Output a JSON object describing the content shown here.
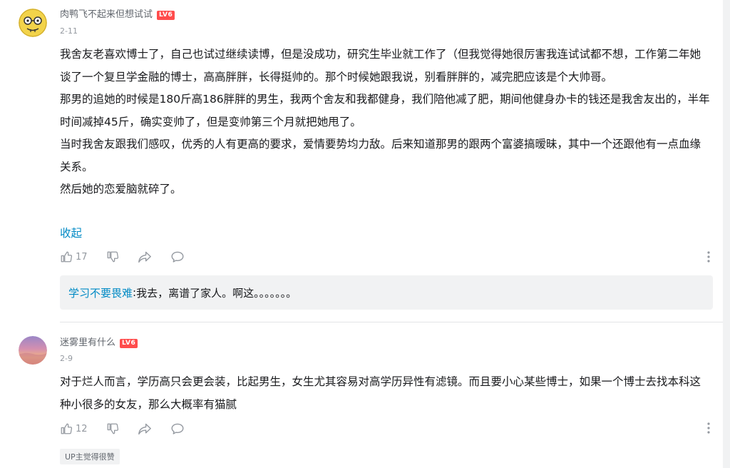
{
  "comments": [
    {
      "username": "肉鸭飞不起来但想试试",
      "level": "LV6",
      "date": "2-11",
      "paragraphs": [
        "我舍友老喜欢博士了，自己也试过继续读博，但是没成功，研究生毕业就工作了（但我觉得她很厉害我连试试都不想，工作第二年她谈了一个复旦学金融的博士，高高胖胖，长得挺帅的。那个时候她跟我说，别看胖胖的，减完肥应该是个大帅哥。",
        "那男的追她的时候是180斤高186胖胖的男生，我两个舍友和我都健身，我们陪他减了肥，期间他健身办卡的钱还是我舍友出的，半年时间减掉45斤，确实变帅了，但是变帅第三个月就把她甩了。",
        "当时我舍友跟我们感叹，优秀的人有更高的要求，爱情要势均力敌。后来知道那男的跟两个富婆搞暧昧，其中一个还跟他有一点血缘关系。",
        "然后她的恋爱脑就碎了。"
      ],
      "collapse_label": "收起",
      "likes": "17",
      "reply": {
        "user": "学习不要畏难",
        "separator": ": ",
        "text": "我去，离谱了家人。啊这。。。。。。。"
      }
    },
    {
      "username": "迷雾里有什么",
      "level": "LV6",
      "date": "2-9",
      "paragraphs": [
        "对于烂人而言，学历高只会更会装，比起男生，女生尤其容易对高学历异性有滤镜。而且要小心某些博士，如果一个博士去找本科这种小很多的女友，那么大概率有猫腻"
      ],
      "likes": "12",
      "up_badge": "UP主觉得很赞"
    }
  ],
  "icons": {
    "like": "thumbs-up-icon",
    "dislike": "thumbs-down-icon",
    "share": "share-icon",
    "reply": "reply-bubble-icon",
    "more": "more-vertical-icon"
  },
  "colors": {
    "link": "#008ac5",
    "badge": "#ff4c4c",
    "muted": "#9499a0"
  }
}
